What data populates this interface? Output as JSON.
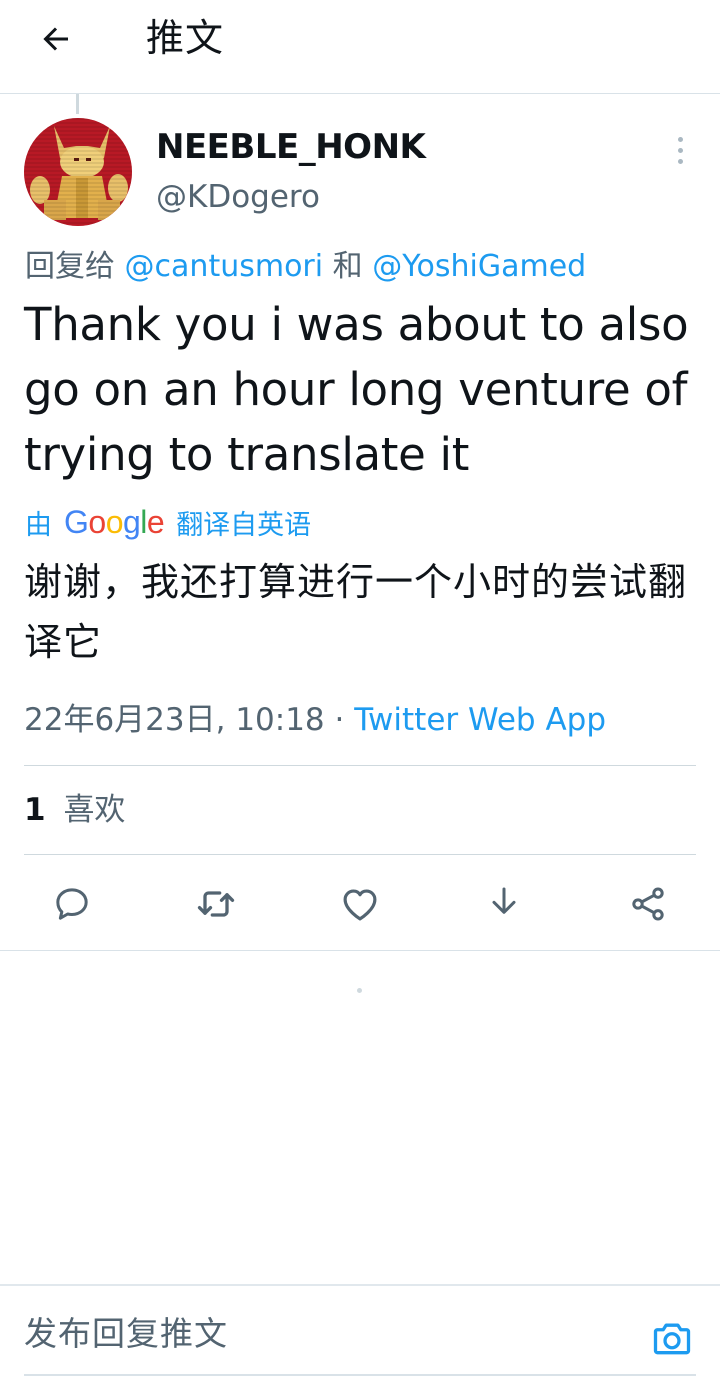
{
  "header": {
    "title": "推文",
    "back_icon": "arrow-left-icon"
  },
  "tweet": {
    "author_name": "NEEBLE_HONK",
    "author_handle": "@KDogero",
    "reply_prefix": "回复给",
    "reply_mention_1": "@cantusmori",
    "reply_conjunction": "和",
    "reply_mention_2": "@YoshiGamed",
    "text": "Thank you i was about to also go on an hour long venture of trying to translate it",
    "translation": {
      "by_label": "由",
      "provider": "Google",
      "from_label": "翻译自英语",
      "text": "谢谢，我还打算进行一个小时的尝试翻译它"
    },
    "timestamp": "22年6月23日, 10:18",
    "separator": "·",
    "source_app": "Twitter Web App",
    "likes_count": "1",
    "likes_label": "喜欢"
  },
  "actions": [
    {
      "name": "reply",
      "icon": "reply-bubble-icon"
    },
    {
      "name": "retweet",
      "icon": "retweet-icon"
    },
    {
      "name": "like",
      "icon": "heart-icon"
    },
    {
      "name": "download",
      "icon": "download-icon"
    },
    {
      "name": "share",
      "icon": "share-icon"
    }
  ],
  "compose": {
    "placeholder": "发布回复推文",
    "camera_icon": "camera-icon"
  },
  "colors": {
    "accent": "#1d9bf0",
    "text": "#0f1419",
    "secondary": "#536471",
    "border": "#cfd9de"
  }
}
